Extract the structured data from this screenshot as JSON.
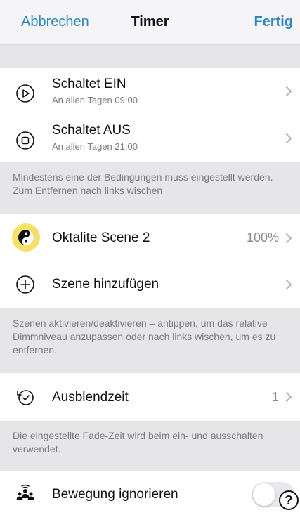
{
  "nav": {
    "cancel": "Abbrechen",
    "title": "Timer",
    "done": "Fertig"
  },
  "schedule": {
    "items": [
      {
        "title": "Schaltet EIN",
        "subtitle": "An allen Tagen  09:00",
        "icon": "play-circle-icon"
      },
      {
        "title": "Schaltet AUS",
        "subtitle": "An allen Tagen  21:00",
        "icon": "stop-circle-icon"
      }
    ],
    "footer": "Mindestens eine der Bedingungen muss eingestellt werden. Zum Entfernen nach links wischen"
  },
  "scenes": {
    "items": [
      {
        "title": "Oktalite Scene 2",
        "value": "100%",
        "icon": "yin-yang-icon"
      },
      {
        "title": "Szene hinzufügen",
        "icon": "add-circle-icon"
      }
    ],
    "footer": "Szenen aktivieren/deaktivieren – antippen, um das relative Dimmniveau anzupassen oder nach links wischen, um es zu entfernen."
  },
  "fade": {
    "title": "Ausblendzeit",
    "value": "1",
    "icon": "fade-timer-icon",
    "footer": "Die eingestellte Fade-Zeit wird beim ein- und ausschalten verwendet."
  },
  "motion": {
    "title": "Bewegung ignorieren",
    "icon": "people-motion-icon",
    "toggle_on": false,
    "help_label": "?"
  },
  "colors": {
    "accent": "#2f84bf",
    "scene_highlight": "#f5e06a",
    "background": "#e6e6e8"
  }
}
